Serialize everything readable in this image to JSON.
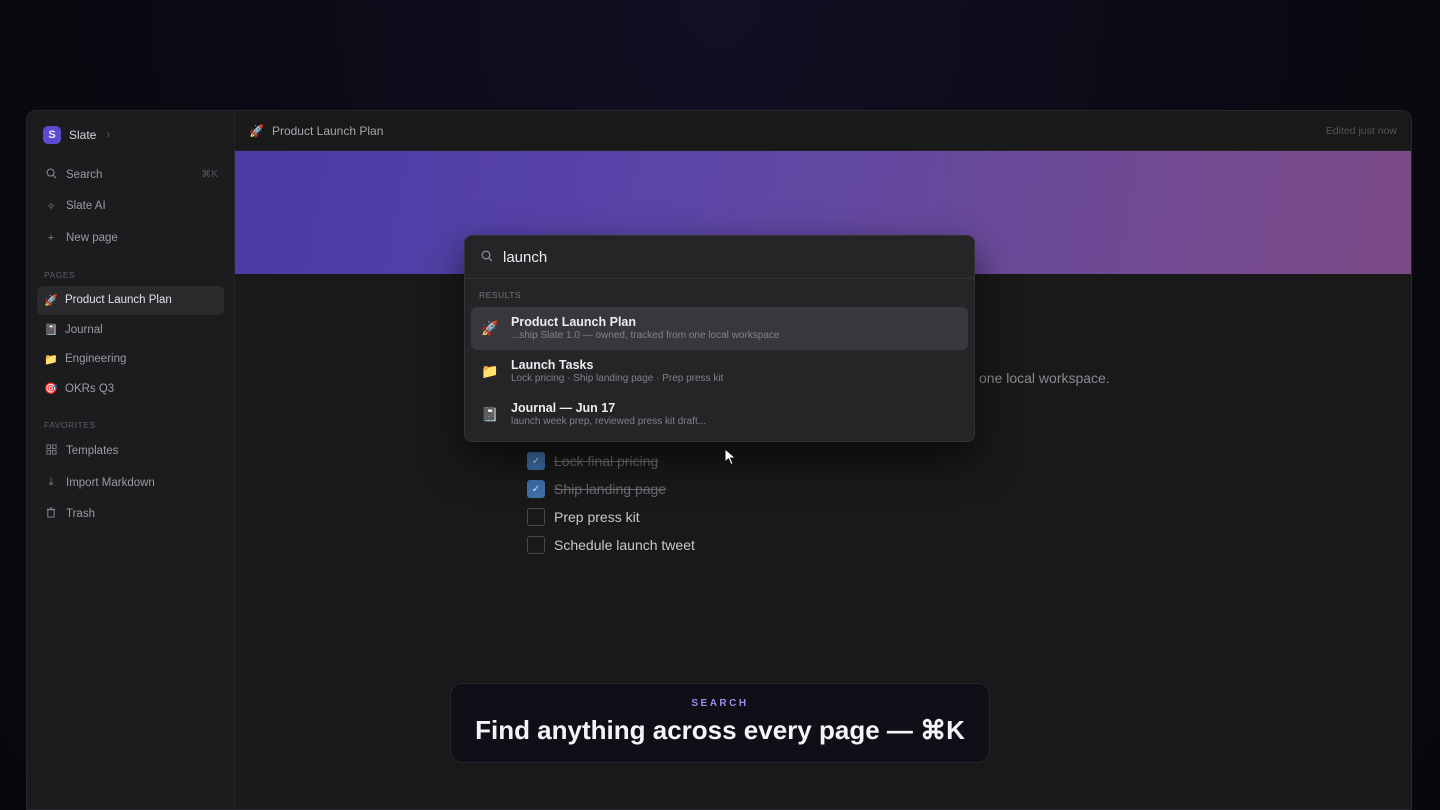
{
  "workspace": {
    "logo_letter": "S",
    "name": "Slate"
  },
  "sidebar": {
    "actions": [
      {
        "label": "Search",
        "icon": "search-icon",
        "shortcut": "⌘K"
      },
      {
        "label": "Slate AI",
        "icon": "sparkle-icon"
      },
      {
        "label": "New page",
        "icon": "plus-icon"
      }
    ],
    "pages_heading": "PAGES",
    "pages": [
      {
        "label": "Product Launch Plan",
        "emoji": "🚀",
        "active": true
      },
      {
        "label": "Journal",
        "emoji": "📓"
      },
      {
        "label": "Engineering",
        "emoji": "📁"
      },
      {
        "label": "OKRs Q3",
        "emoji": "🎯"
      }
    ],
    "favorites_heading": "FAVORITES",
    "favorites": [
      {
        "label": "Templates",
        "icon": "grid-icon"
      },
      {
        "label": "Import Markdown",
        "icon": "download-icon"
      },
      {
        "label": "Trash",
        "icon": "trash-icon"
      }
    ]
  },
  "topbar": {
    "breadcrumb_emoji": "🚀",
    "breadcrumb": "Product Launch Plan",
    "status": "Edited just now"
  },
  "document": {
    "visible_text": "one local workspace.",
    "todos": [
      {
        "label": "Lock final pricing",
        "checked": true
      },
      {
        "label": "Ship landing page",
        "checked": true
      },
      {
        "label": "Prep press kit",
        "checked": false
      },
      {
        "label": "Schedule launch tweet",
        "checked": false
      }
    ]
  },
  "palette": {
    "query": "launch",
    "results_heading": "RESULTS",
    "results": [
      {
        "title": "Product Launch Plan",
        "subtitle": "...ship Slate 1.0 — owned, tracked from one local workspace",
        "emoji": "🚀",
        "selected": true
      },
      {
        "title": "Launch Tasks",
        "subtitle": "Lock pricing · Ship landing page · Prep press kit",
        "emoji": "📁"
      },
      {
        "title": "Journal — Jun 17",
        "subtitle": "launch week prep, reviewed press kit draft...",
        "emoji": "📓"
      }
    ]
  },
  "caption": {
    "tag": "SEARCH",
    "text": "Find anything across every page — ⌘K"
  }
}
